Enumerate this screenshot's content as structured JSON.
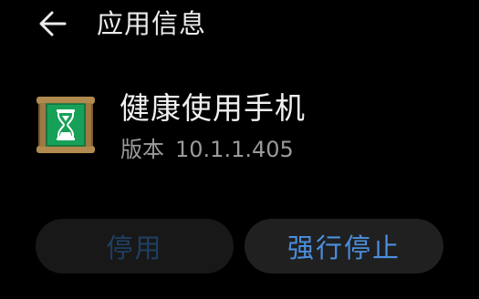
{
  "header": {
    "back_icon": "arrow-left-icon",
    "title": "应用信息"
  },
  "app": {
    "icon": "hourglass-icon",
    "name": "健康使用手机",
    "version_label": "版本",
    "version_value": "10.1.1.405"
  },
  "actions": {
    "disable_label": "停用",
    "disable_enabled": false,
    "force_stop_label": "强行停止",
    "force_stop_enabled": true
  },
  "colors": {
    "background": "#000000",
    "accent": "#4b8fde",
    "disabled_text": "#1f3f63",
    "button_bg": "#202020",
    "icon_green": "#1aa35a",
    "icon_wood": "#8a6a3a"
  }
}
